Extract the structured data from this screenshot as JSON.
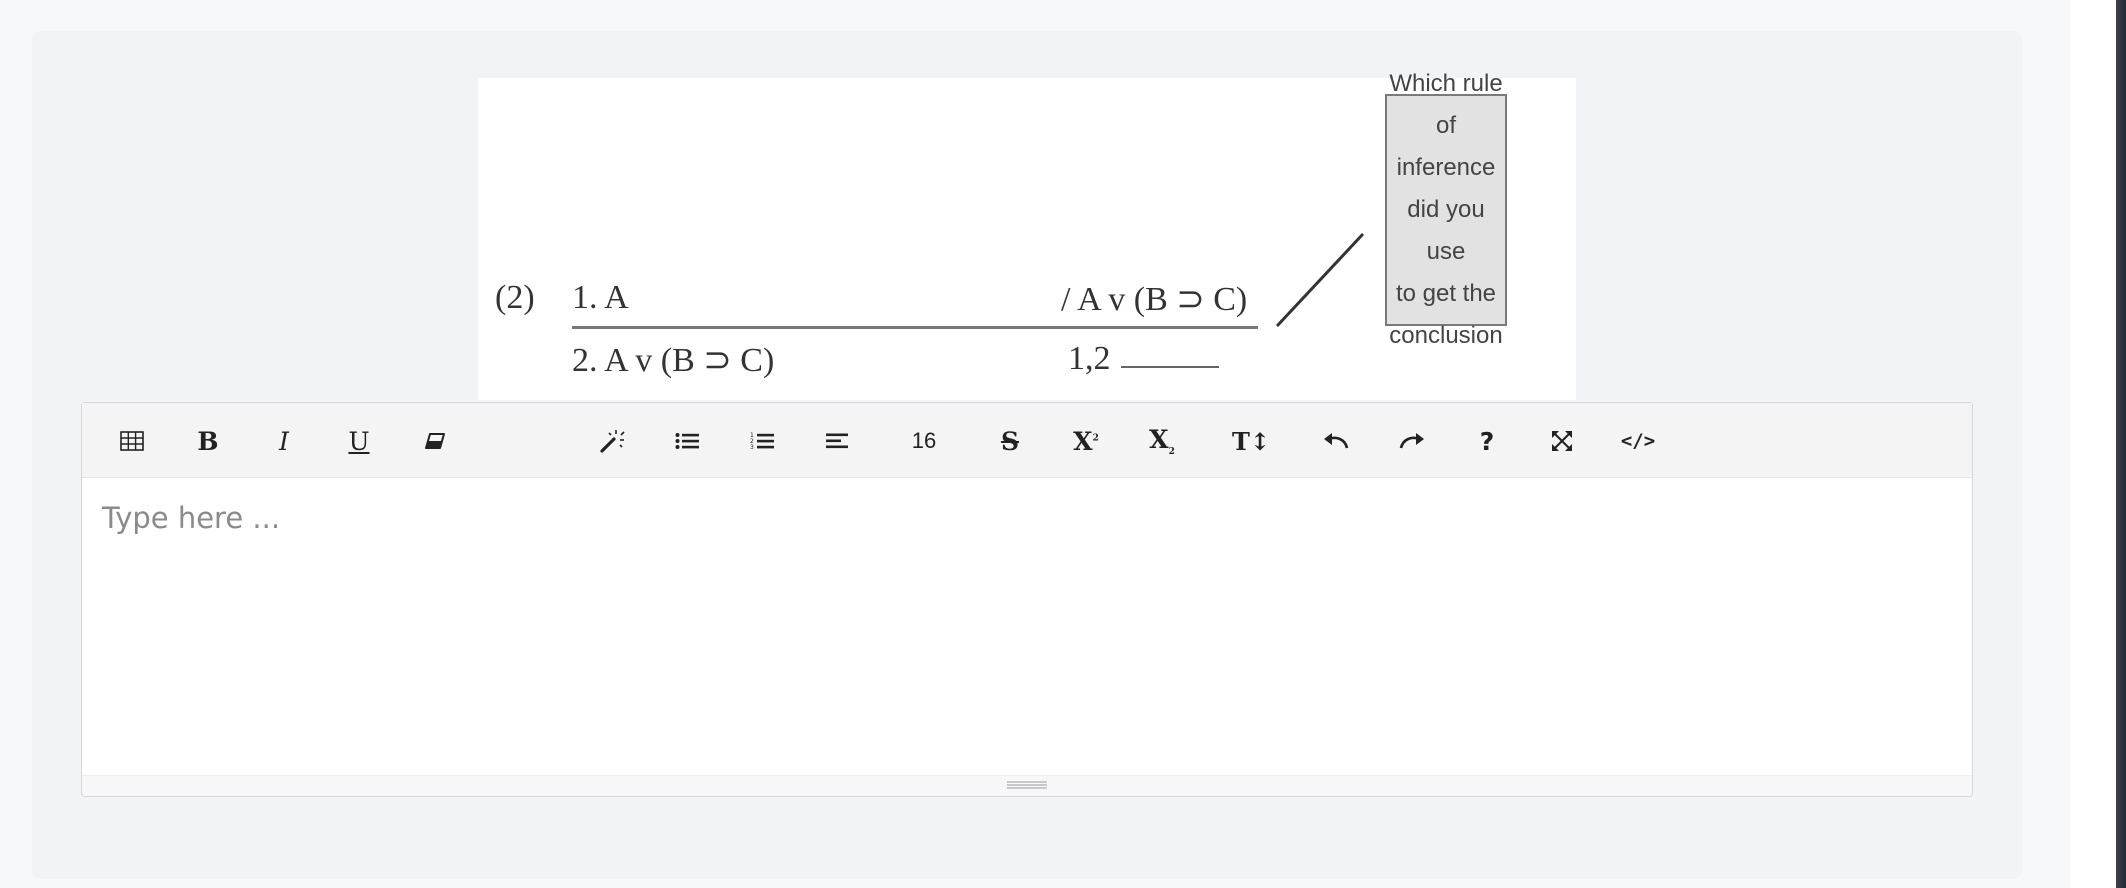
{
  "figure": {
    "problem_number": "(2)",
    "premise_1": "1. A",
    "conclusion": "/ A v (B ⊃ C)",
    "line_2": "2. A v (B ⊃ C)",
    "justification": "1,2",
    "question_lines": [
      "Which rule",
      "of inference",
      "did you use",
      "to get the",
      "conclusion"
    ]
  },
  "toolbar": {
    "table": "table-icon",
    "bold": "B",
    "italic": "I",
    "underline": "U",
    "eraser": "eraser-icon",
    "magic": "magic-wand-icon",
    "bullets": "unordered-list-icon",
    "numbers": "ordered-list-icon",
    "align": "align-icon",
    "font_size": "16",
    "strike": "S",
    "superscript": "X",
    "subscript": "X",
    "text_height": "T↕",
    "undo": "undo-icon",
    "redo": "redo-icon",
    "help": "?",
    "fullscreen": "fullscreen-icon",
    "code": "</>"
  },
  "editor": {
    "placeholder": "Type here ..."
  }
}
